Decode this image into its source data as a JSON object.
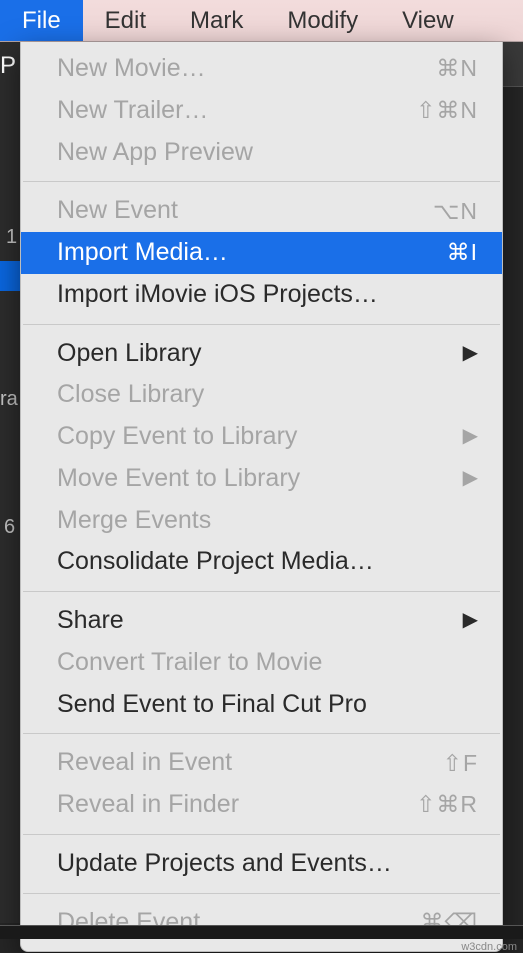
{
  "menubar": {
    "items": [
      {
        "label": "File",
        "active": true
      },
      {
        "label": "Edit",
        "active": false
      },
      {
        "label": "Mark",
        "active": false
      },
      {
        "label": "Modify",
        "active": false
      },
      {
        "label": "View",
        "active": false
      }
    ]
  },
  "dropdown": {
    "groups": [
      [
        {
          "label": "New Movie…",
          "shortcut": "⌘N",
          "enabled": false,
          "submenu": false,
          "selected": false
        },
        {
          "label": "New Trailer…",
          "shortcut": "⇧⌘N",
          "enabled": false,
          "submenu": false,
          "selected": false
        },
        {
          "label": "New App Preview",
          "shortcut": "",
          "enabled": false,
          "submenu": false,
          "selected": false
        }
      ],
      [
        {
          "label": "New Event",
          "shortcut": "⌥N",
          "enabled": false,
          "submenu": false,
          "selected": false
        },
        {
          "label": "Import Media…",
          "shortcut": "⌘I",
          "enabled": true,
          "submenu": false,
          "selected": true
        },
        {
          "label": "Import iMovie iOS Projects…",
          "shortcut": "",
          "enabled": true,
          "submenu": false,
          "selected": false
        }
      ],
      [
        {
          "label": "Open Library",
          "shortcut": "",
          "enabled": true,
          "submenu": true,
          "selected": false
        },
        {
          "label": "Close Library",
          "shortcut": "",
          "enabled": false,
          "submenu": false,
          "selected": false
        },
        {
          "label": "Copy Event to Library",
          "shortcut": "",
          "enabled": false,
          "submenu": true,
          "selected": false
        },
        {
          "label": "Move Event to Library",
          "shortcut": "",
          "enabled": false,
          "submenu": true,
          "selected": false
        },
        {
          "label": "Merge Events",
          "shortcut": "",
          "enabled": false,
          "submenu": false,
          "selected": false
        },
        {
          "label": "Consolidate Project Media…",
          "shortcut": "",
          "enabled": true,
          "submenu": false,
          "selected": false
        }
      ],
      [
        {
          "label": "Share",
          "shortcut": "",
          "enabled": true,
          "submenu": true,
          "selected": false
        },
        {
          "label": "Convert Trailer to Movie",
          "shortcut": "",
          "enabled": false,
          "submenu": false,
          "selected": false
        },
        {
          "label": "Send Event to Final Cut Pro",
          "shortcut": "",
          "enabled": true,
          "submenu": false,
          "selected": false
        }
      ],
      [
        {
          "label": "Reveal in Event",
          "shortcut": "⇧F",
          "enabled": false,
          "submenu": false,
          "selected": false
        },
        {
          "label": "Reveal in Finder",
          "shortcut": "⇧⌘R",
          "enabled": false,
          "submenu": false,
          "selected": false
        }
      ],
      [
        {
          "label": "Update Projects and Events…",
          "shortcut": "",
          "enabled": true,
          "submenu": false,
          "selected": false
        }
      ],
      [
        {
          "label": "Delete Event",
          "shortcut": "⌘⌫",
          "enabled": false,
          "submenu": false,
          "selected": false
        }
      ]
    ]
  },
  "footer": {
    "credit": "w3cdn.com"
  },
  "background": {
    "top_left_char": "P",
    "side_chars": {
      "a": "1",
      "b": "ra",
      "c": "6"
    }
  }
}
